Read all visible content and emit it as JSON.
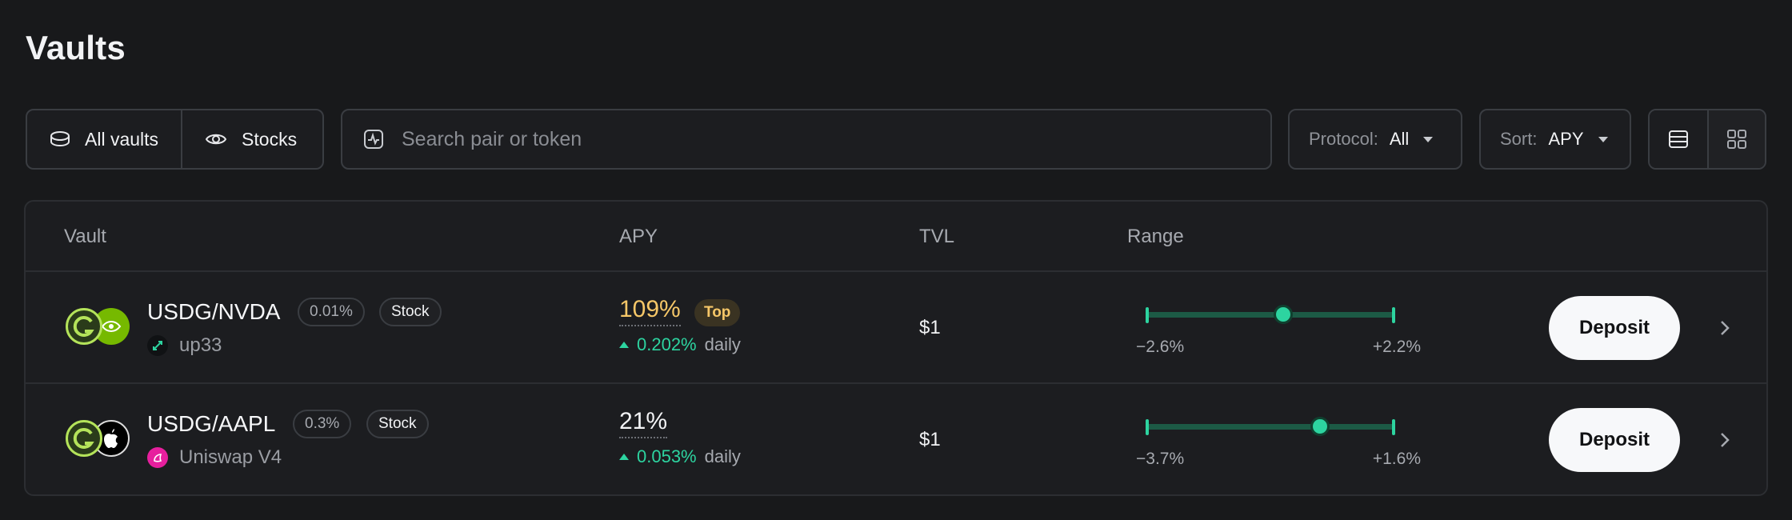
{
  "page": {
    "title": "Vaults"
  },
  "filters": {
    "all_vaults": "All vaults",
    "stocks": "Stocks",
    "search_placeholder": "Search pair or token",
    "protocol_label": "Protocol:",
    "protocol_value": "All",
    "sort_label": "Sort:",
    "sort_value": "APY"
  },
  "table": {
    "columns": {
      "vault": "Vault",
      "apy": "APY",
      "tvl": "TVL",
      "range": "Range"
    },
    "rows": [
      {
        "pair": "USDG/NVDA",
        "fee": "0.01%",
        "tag": "Stock",
        "protocol": "up33",
        "apy": "109%",
        "badge": "Top",
        "daily": "0.202%",
        "daily_label": "daily",
        "tvl": "$1",
        "range_low": "−2.6%",
        "range_high": "+2.2%",
        "range_position": 0.55,
        "action": "Deposit",
        "token_b_icon": "nvidia-icon",
        "protocol_icon": "up33-icon"
      },
      {
        "pair": "USDG/AAPL",
        "fee": "0.3%",
        "tag": "Stock",
        "protocol": "Uniswap V4",
        "apy": "21%",
        "daily": "0.053%",
        "daily_label": "daily",
        "tvl": "$1",
        "range_low": "−3.7%",
        "range_high": "+1.6%",
        "range_position": 0.7,
        "action": "Deposit",
        "token_b_icon": "apple-icon",
        "protocol_icon": "uniswap-icon"
      }
    ]
  },
  "colors": {
    "background": "#18191b",
    "accent_green": "#2dd4a0",
    "top_gold": "#f6c768"
  }
}
